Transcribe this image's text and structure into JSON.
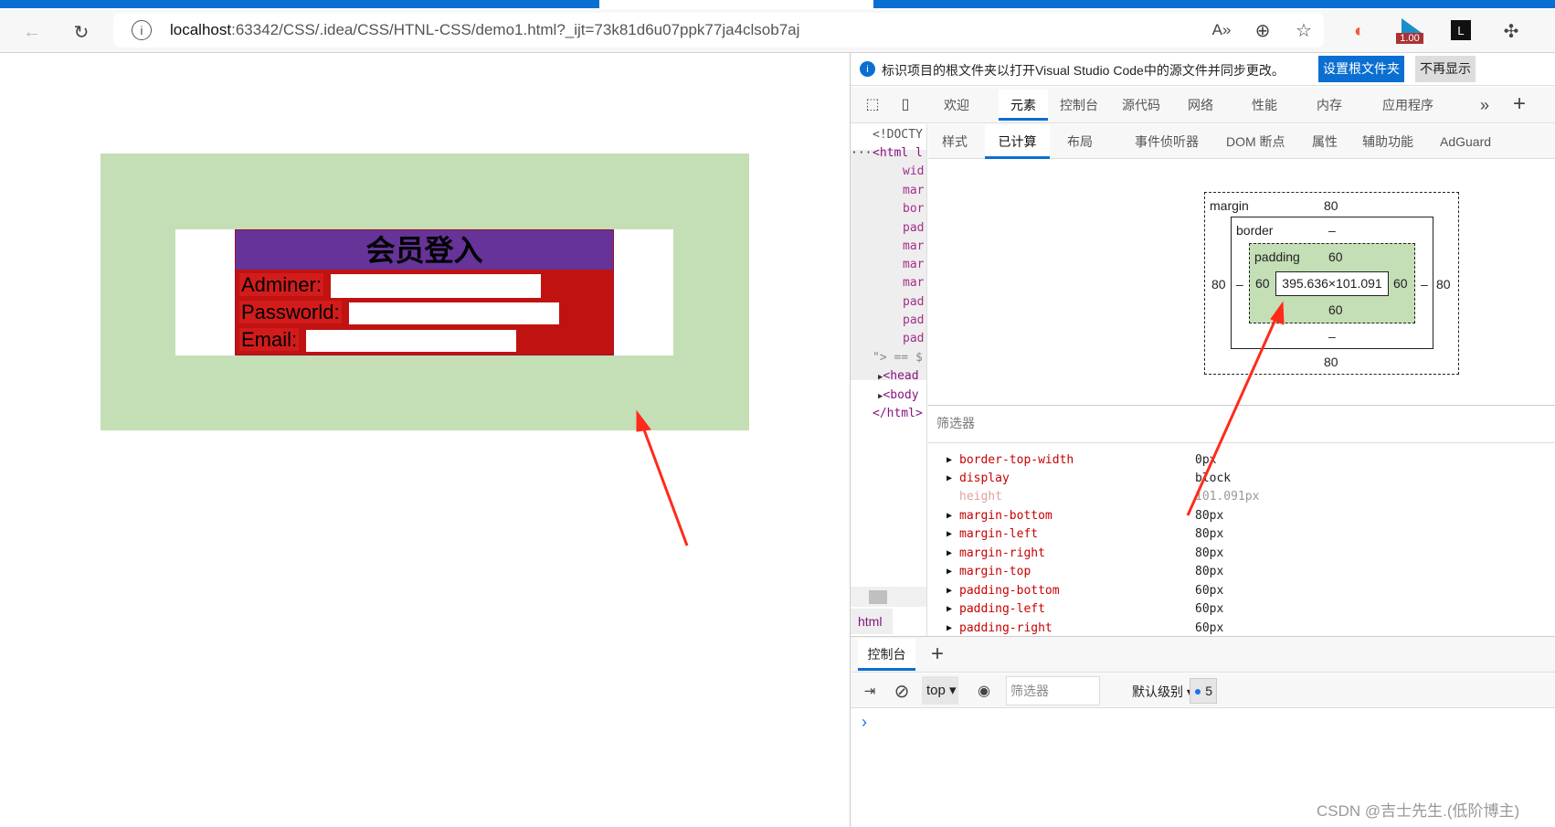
{
  "browser": {
    "url_host": "localhost",
    "url_rest": ":63342/CSS/.idea/CSS/HTNL-CSS/demo1.html?_ijt=73k81d6u07ppk77ja4clsob7aj",
    "ext_badge": "1.00"
  },
  "page": {
    "title": "会员登入",
    "fields": [
      {
        "label": "Adminer:",
        "value": ""
      },
      {
        "label": "Passworld:",
        "value": ""
      },
      {
        "label": "Email:",
        "value": ""
      }
    ]
  },
  "infobar": {
    "text": "标识项目的根文件夹以打开Visual Studio Code中的源文件并同步更改。",
    "primary": "设置根文件夹",
    "secondary": "不再显示"
  },
  "devtools": {
    "tabs": [
      "欢迎",
      "元素",
      "控制台",
      "源代码",
      "网络",
      "性能",
      "内存",
      "应用程序"
    ],
    "active_tab": "元素",
    "subtabs": [
      "样式",
      "已计算",
      "布局",
      "事件侦听器",
      "DOM 断点",
      "属性",
      "辅助功能",
      "AdGuard"
    ],
    "active_subtab": "已计算",
    "dom_lines": [
      "<!DOCTY",
      "<html l",
      "wid",
      "mar",
      "bor",
      "pad",
      "mar",
      "mar",
      "mar",
      "pad",
      "pad",
      "pad",
      "\"> == $",
      "<head",
      "<body",
      "</html>"
    ],
    "breadcrumb": "html",
    "boxmodel": {
      "margin_label": "margin",
      "border_label": "border",
      "padding_label": "padding",
      "margin": {
        "top": "80",
        "right": "80",
        "bottom": "80",
        "left": "80"
      },
      "border": {
        "top": "–",
        "right": "–",
        "bottom": "–",
        "left": "–"
      },
      "padding": {
        "top": "60",
        "right": "60",
        "bottom": "60",
        "left": "60"
      },
      "content": "395.636×101.091"
    },
    "filter_placeholder": "筛选器",
    "properties": [
      {
        "name": "border-top-width",
        "value": "0px"
      },
      {
        "name": "display",
        "value": "block"
      },
      {
        "name": "height",
        "value": "101.091px",
        "inherited": true
      },
      {
        "name": "margin-bottom",
        "value": "80px"
      },
      {
        "name": "margin-left",
        "value": "80px"
      },
      {
        "name": "margin-right",
        "value": "80px"
      },
      {
        "name": "margin-top",
        "value": "80px"
      },
      {
        "name": "padding-bottom",
        "value": "60px"
      },
      {
        "name": "padding-left",
        "value": "60px"
      },
      {
        "name": "padding-right",
        "value": "60px"
      }
    ],
    "drawer": {
      "tab": "控制台",
      "context": "top",
      "filter_placeholder": "筛选器",
      "level": "默认级别",
      "message_count": "5",
      "prompt": "›"
    }
  },
  "watermark": "CSDN @吉士先生.(低阶博主)",
  "colors": {
    "green": "#c4deb6",
    "purple": "#663399",
    "red": "#c11212",
    "accent": "#0a6fd1",
    "arrow": "#ff2a1a"
  }
}
